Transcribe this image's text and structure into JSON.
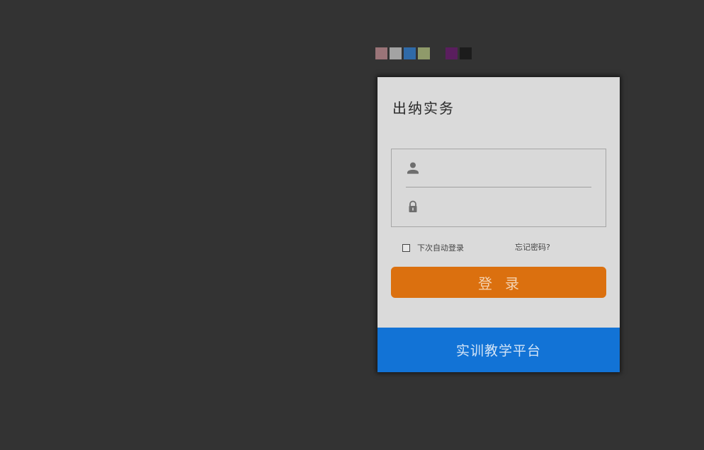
{
  "theme": {
    "swatches": [
      "#9a7478",
      "#a3a3a3",
      "#2f6aa8",
      "#8f9a6a",
      "#5a1e5e",
      "#1c1c1c"
    ],
    "accent_orange": "#db700f",
    "accent_blue": "#1273d6",
    "background": "#333333"
  },
  "login": {
    "title": "出纳实务",
    "username": {
      "icon": "user-icon",
      "value": "",
      "placeholder": ""
    },
    "password": {
      "icon": "lock-icon",
      "value": "",
      "placeholder": ""
    },
    "remember_label": "下次自动登录",
    "remember_checked": false,
    "forgot_label": "忘记密码?",
    "submit_label": "登录"
  },
  "footer": {
    "text": "实训教学平台"
  }
}
